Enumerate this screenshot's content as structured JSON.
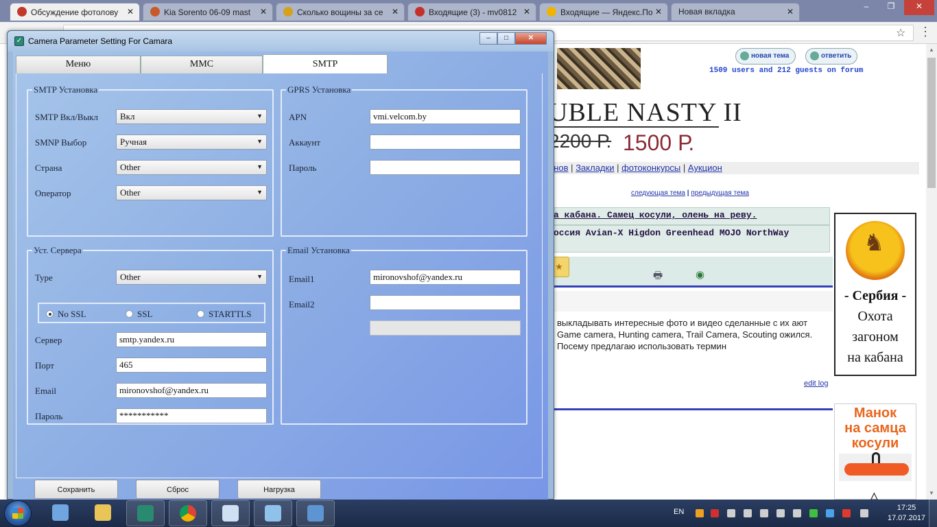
{
  "browser": {
    "tabs": [
      {
        "title": "Обсуждение фотолову",
        "active": true,
        "favicon_color": "#c0392b"
      },
      {
        "title": "Kia Sorento 06-09 mast",
        "active": false,
        "favicon_color": "#c85a2a"
      },
      {
        "title": "Сколько вощины за се",
        "active": false,
        "favicon_color": "#d6a11c"
      },
      {
        "title": "Входящие (3) - mv0812",
        "active": false,
        "favicon_color": "#c4302b"
      },
      {
        "title": "Входящие — Яндекс.По",
        "active": false,
        "favicon_color": "#f0b400"
      },
      {
        "title": "Новая вкладка",
        "active": false,
        "favicon_color": ""
      }
    ],
    "tab_close_glyph": "✕",
    "window_controls": [
      "–",
      "❐",
      "✕"
    ]
  },
  "forum": {
    "btn_new_topic": "новая тема",
    "btn_reply": "ответить",
    "users_line": "1509 users and 212 guests on forum",
    "ad_title": "UBLE NASTY II",
    "ad_old_price": "2200 Р.",
    "ad_new_price": "1500 Р.",
    "nav_links": [
      "анов",
      "Закладки",
      "фотоконкурсы",
      "Аукцион"
    ],
    "nav_sep": "|",
    "topic_nav_prev": "следующая тема",
    "topic_nav_sep": "|",
    "topic_nav_next": "предыдущая тема",
    "topic1": "а кабана. Самец косули, олень на реву.",
    "topic2": "оссия Avian-X Higdon Greenhead MOJO NorthWay",
    "post_text": "выкладывать интересные фото и видео сделанные с их ают Game camera, Hunting camera, Trail Camera, Scouting ожился. Посему предлагаю использовать термин",
    "edit_log": "edit log",
    "ad_serbia": {
      "line1": "- Сербия -",
      "line2": "Охота",
      "line3": "загоном",
      "line4": "на кабана"
    },
    "ad_manok": {
      "line1": "Манок",
      "line2": "на самца",
      "line3": "косули",
      "accent": "#e8661c"
    }
  },
  "app": {
    "title": "Camera Parameter Setting For  Camara",
    "tabs": [
      {
        "label": "Меню",
        "selected": false
      },
      {
        "label": "MMC",
        "selected": false
      },
      {
        "label": "SMTP",
        "selected": true
      }
    ],
    "smtp_group": {
      "legend": "SMTP Установка",
      "rows": [
        {
          "label": "SMTP Вкл/Выкл",
          "value": "Вкл"
        },
        {
          "label": "SMNP Выбор",
          "value": "Ручная"
        },
        {
          "label": "Страна",
          "value": "Other"
        },
        {
          "label": "Оператор",
          "value": "Other"
        }
      ]
    },
    "gprs_group": {
      "legend": "GPRS Установка",
      "rows": [
        {
          "label": "APN",
          "value": "vmi.velcom.by"
        },
        {
          "label": "Аккаунт",
          "value": ""
        },
        {
          "label": "Пароль",
          "value": ""
        }
      ]
    },
    "server_group": {
      "legend": "Уст. Сервера",
      "type_label": "Type",
      "type_value": "Other",
      "ssl_options": [
        {
          "label": "No SSL",
          "selected": true
        },
        {
          "label": "SSL",
          "selected": false
        },
        {
          "label": "STARTTLS",
          "selected": false
        }
      ],
      "rows": [
        {
          "label": "Сервер",
          "value": "smtp.yandex.ru"
        },
        {
          "label": "Порт",
          "value": "465"
        },
        {
          "label": "Email",
          "value": "mironovshof@yandex.ru"
        },
        {
          "label": "Пароль",
          "value": "***********"
        }
      ]
    },
    "email_group": {
      "legend": "Email Установка",
      "rows": [
        {
          "label": "Email1",
          "value": "mironovshof@yandex.ru"
        },
        {
          "label": "Email2",
          "value": ""
        },
        {
          "label": "",
          "value": "",
          "disabled": true
        }
      ]
    },
    "buttons": {
      "save": "Сохранить",
      "reset": "Сброс",
      "load": "Нагрузка"
    }
  },
  "taskbar": {
    "lang": "EN",
    "time": "17:25",
    "date": "17.07.2017",
    "tray_colors": [
      "#f0a020",
      "#d03030",
      "#cfcfcf",
      "#cfcfcf",
      "#cfcfcf",
      "#cfcfcf",
      "#cfcfcf",
      "#3fbf3f",
      "#4aa3e8",
      "#e03a2a",
      "#cfcfcf"
    ]
  }
}
